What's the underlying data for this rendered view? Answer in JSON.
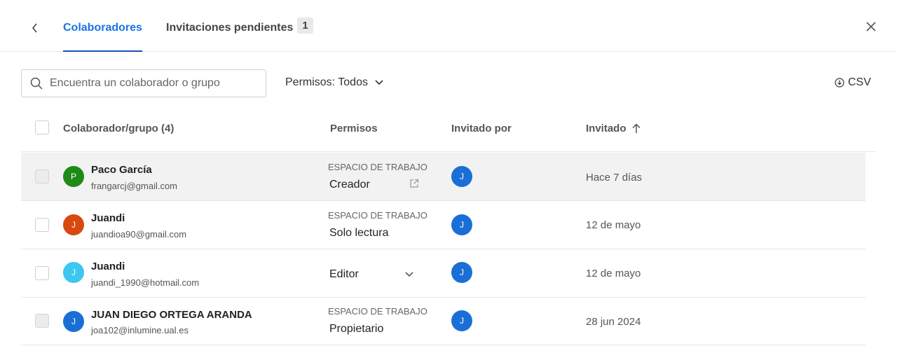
{
  "tabs": {
    "collaborators_label": "Colaboradores",
    "pending_label": "Invitaciones pendientes",
    "pending_count": "1"
  },
  "toolbar": {
    "search_placeholder": "Encuentra un colaborador o grupo",
    "permissions_filter": "Permisos: Todos",
    "csv_label": "CSV"
  },
  "table": {
    "columns": {
      "collaborator": "Colaborador/grupo (4)",
      "permissions": "Permisos",
      "invited_by": "Invitado por",
      "invited": "Invitado"
    },
    "rows": [
      {
        "initial": "P",
        "avatar_color": "#1e8a17",
        "name": "Paco García",
        "email": "frangarcj@gmail.com",
        "scope": "ESPACIO DE TRABAJO",
        "role": "Creador",
        "inviter_initial": "J",
        "date": "Hace 7 días"
      },
      {
        "initial": "J",
        "avatar_color": "#d9480f",
        "name": "Juandi",
        "email": "juandioa90@gmail.com",
        "scope": "ESPACIO DE TRABAJO",
        "role": "Solo lectura",
        "inviter_initial": "J",
        "date": "12 de mayo"
      },
      {
        "initial": "J",
        "avatar_color": "#3cc6f0",
        "name": "Juandi",
        "email": "juandi_1990@hotmail.com",
        "scope": "",
        "role": "Editor",
        "inviter_initial": "J",
        "date": "12 de mayo"
      },
      {
        "initial": "J",
        "avatar_color": "#1a6fd6",
        "name": "JUAN DIEGO ORTEGA ARANDA",
        "email": "joa102@inlumine.ual.es",
        "scope": "ESPACIO DE TRABAJO",
        "role": "Propietario",
        "inviter_initial": "J",
        "date": "28 jun 2024"
      }
    ]
  },
  "icons": {
    "back": "chevron-left-icon",
    "close": "close-icon",
    "search": "search-icon",
    "dropdown": "chevron-down-icon",
    "download": "download-icon",
    "sort": "arrow-up-icon",
    "external": "external-link-icon"
  },
  "colors": {
    "accent": "#1a73e8",
    "tab_underline": "#1a4fb8",
    "inviter_avatar": "#1a6fd6",
    "highlight_row": "#f2f2f2"
  }
}
